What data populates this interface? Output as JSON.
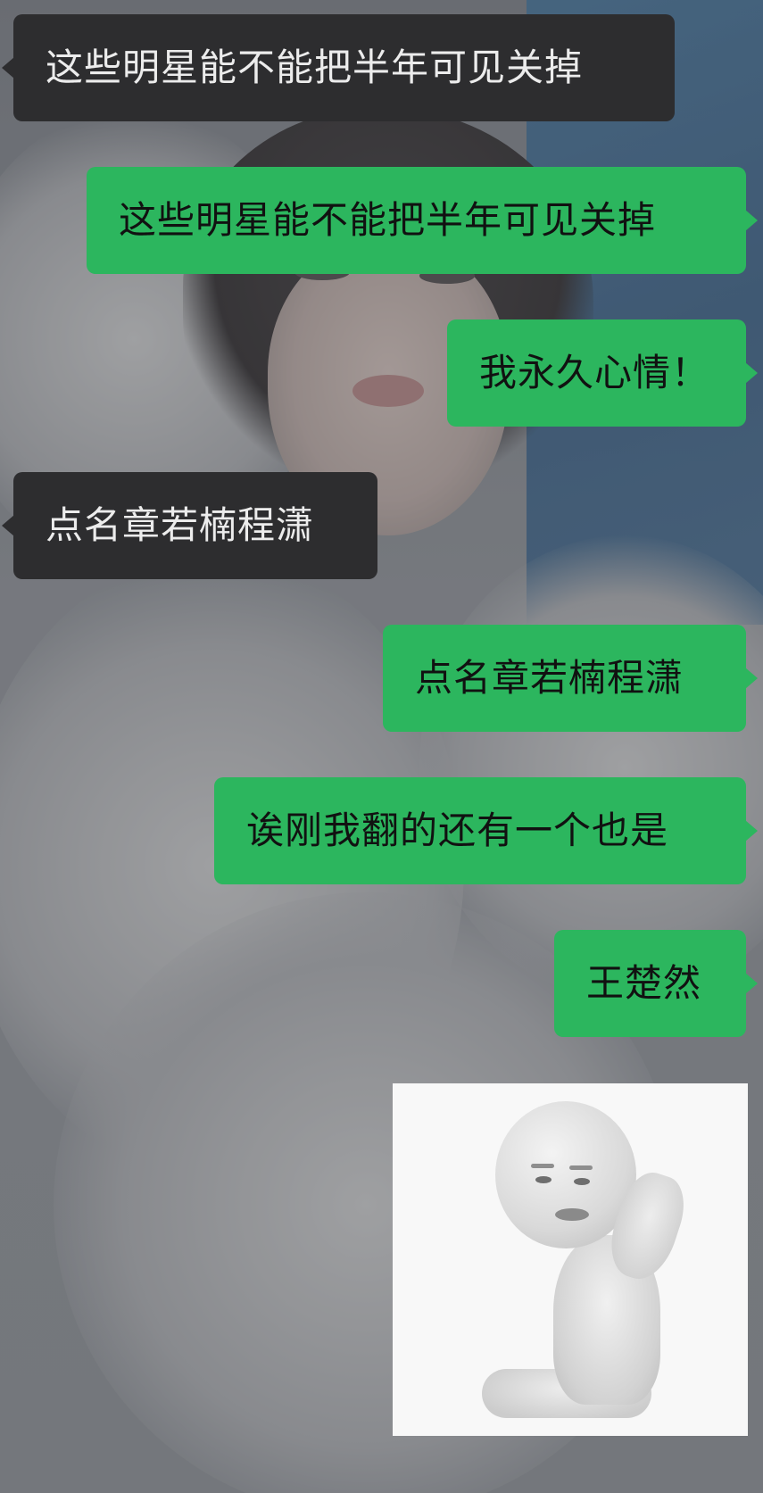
{
  "chat": {
    "messages": [
      {
        "sender": "other",
        "text": "这些明星能不能把半年可见关掉"
      },
      {
        "sender": "me",
        "text": "这些明星能不能把半年可见关掉"
      },
      {
        "sender": "me",
        "text": "我永久心情！"
      },
      {
        "sender": "other",
        "text": "点名章若楠程潇"
      },
      {
        "sender": "me",
        "text": "点名章若楠程潇"
      },
      {
        "sender": "me",
        "text": "诶刚我翻的还有一个也是"
      },
      {
        "sender": "me",
        "text": "王楚然"
      }
    ],
    "sticker": {
      "sender": "me",
      "icon": "kneeling-praying-figure-sticker"
    }
  },
  "colors": {
    "incoming_bubble": "#2d2d2f",
    "outgoing_bubble": "#2cb65e",
    "incoming_text": "#ececec",
    "outgoing_text": "#111111"
  }
}
